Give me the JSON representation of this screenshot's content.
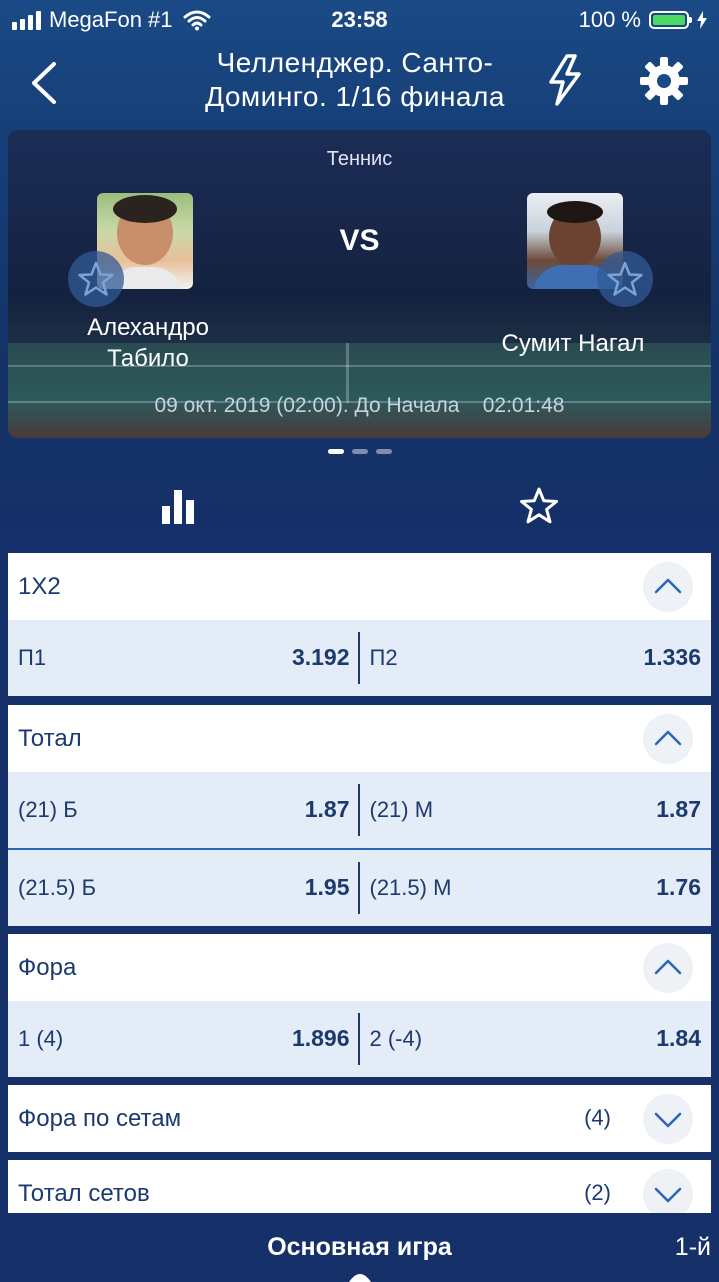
{
  "status_bar": {
    "carrier": "MegaFon #1",
    "time": "23:58",
    "battery": "100 %"
  },
  "nav": {
    "title_line1": "Челленджер. Санто-",
    "title_line2": "Доминго. 1/16 финала"
  },
  "match": {
    "sport": "Теннис",
    "vs": "VS",
    "player1_line1": "Алехандро",
    "player1_line2": "Табило",
    "player2": "Сумит Нагал",
    "start_info": "09 окт. 2019 (02:00). До Начала    02:01:48"
  },
  "markets": [
    {
      "title": "1X2",
      "rows": [
        {
          "l_label": "П1",
          "l_odd": "3.192",
          "r_label": "П2",
          "r_odd": "1.336"
        }
      ]
    },
    {
      "title": "Тотал",
      "rows": [
        {
          "l_label": "(21) Б",
          "l_odd": "1.87",
          "r_label": "(21) М",
          "r_odd": "1.87"
        },
        {
          "l_label": "(21.5) Б",
          "l_odd": "1.95",
          "r_label": "(21.5) М",
          "r_odd": "1.76"
        }
      ]
    },
    {
      "title": "Фора",
      "rows": [
        {
          "l_label": "1 (4)",
          "l_odd": "1.896",
          "r_label": "2 (-4)",
          "r_odd": "1.84"
        }
      ]
    },
    {
      "title": "Фора по сетам",
      "count": "(4)"
    },
    {
      "title": "Тотал сетов",
      "count": "(2)"
    }
  ],
  "bottom": {
    "title": "Основная игра",
    "right": "1-й"
  },
  "colors": {
    "accent": "#1b3a6e",
    "row_bg": "#e4ecf7",
    "divider": "#2a66b8",
    "battery": "#4cd964"
  }
}
